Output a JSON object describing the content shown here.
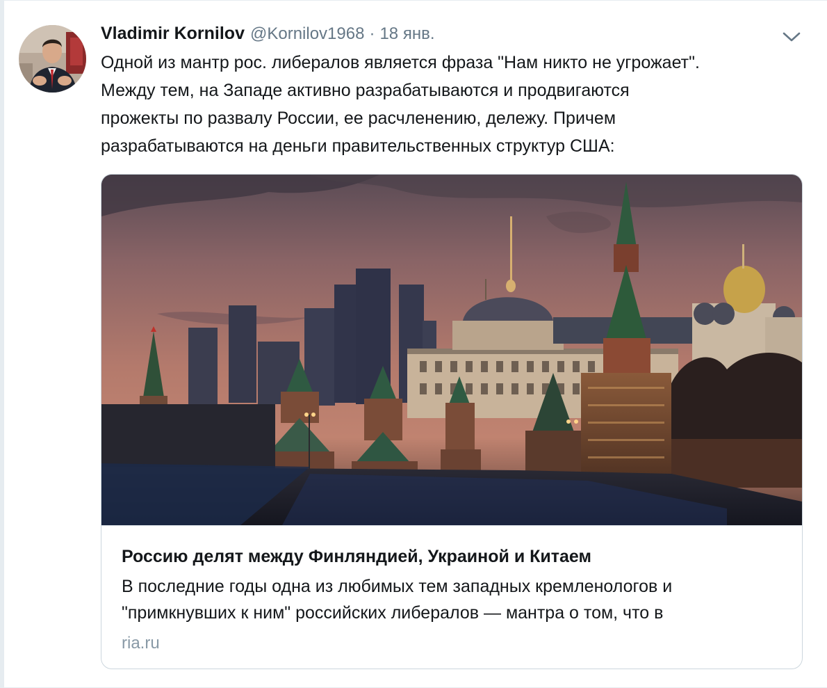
{
  "tweet": {
    "author_name": "Vladimir Kornilov",
    "handle": "@Kornilov1968",
    "separator": "·",
    "date": "18 янв.",
    "text_lines": [
      "Одной из мантр рос. либералов является фраза \"Нам никто не угрожает\".",
      "Между тем, на Западе активно разрабатываются и продвигаются",
      "прожекты по развалу России, ее расчленению, дележу. Причем",
      "разрабатываются на деньги правительственных структур США:"
    ],
    "icons": {
      "avatar": "avatar-photo",
      "menu": "chevron-down-icon"
    }
  },
  "card": {
    "image_subject": "kremlin-photo",
    "title": "Россию делят между Финляндией, Украиной и Китаем",
    "description_lines": [
      "В последние годы одна из любимых тем западных кремленологов и",
      "\"примкнувших к ним\" российских либералов — мантра о том, что в"
    ],
    "domain": "ria.ru"
  },
  "colors": {
    "text_primary": "#14171a",
    "text_secondary": "#657786",
    "domain": "#8899a6",
    "border": "#ccd6dd",
    "background": "#e6ecf0"
  }
}
